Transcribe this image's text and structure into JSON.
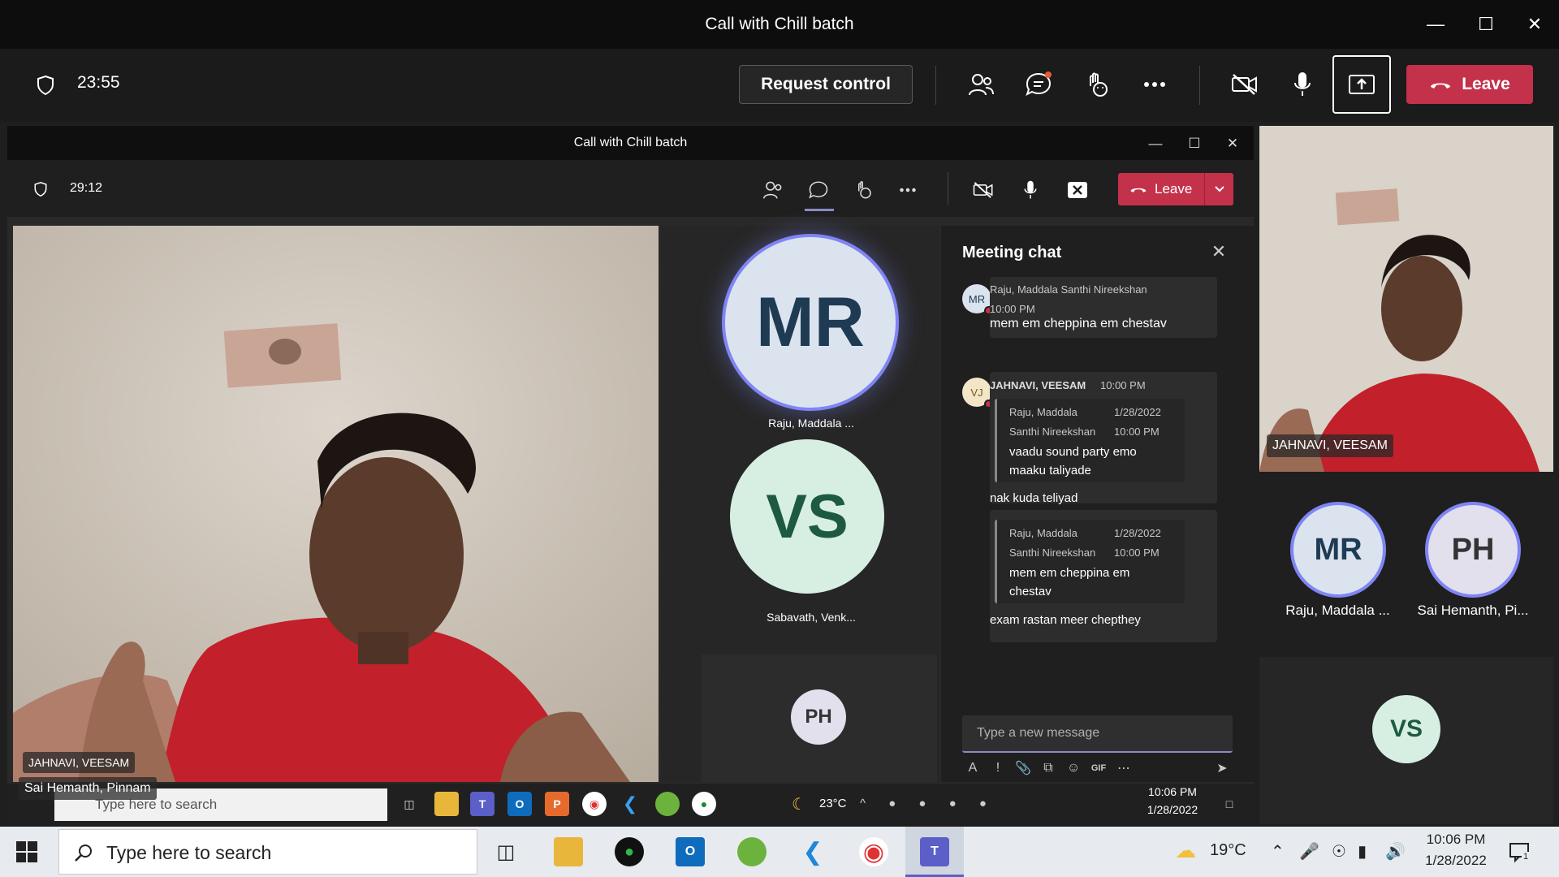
{
  "outer": {
    "title": "Call with Chill batch",
    "timer": "23:55",
    "request_control": "Request control",
    "leave": "Leave"
  },
  "inner": {
    "title": "Call with Chill batch",
    "timer": "29:12",
    "leave": "Leave"
  },
  "main_video": {
    "name": "JAHNAVI, VEESAM"
  },
  "roster": [
    {
      "initials": "MR",
      "label": "Raju, Maddala ..."
    },
    {
      "initials": "VS",
      "label": "Sabavath, Venk..."
    },
    {
      "initials": "PH"
    }
  ],
  "chat": {
    "title": "Meeting chat",
    "messages": [
      {
        "avatar": "MR",
        "author": "Raju, Maddala Santhi Nireekshan",
        "time": "10:00 PM",
        "text": "mem em cheppina em chestav"
      },
      {
        "avatar": "VJ",
        "author": "JAHNAVI, VEESAM",
        "time": "10:00 PM",
        "quote": {
          "author_line1": "Raju, Maddala",
          "author_line2": "Santhi Nireekshan",
          "date": "1/28/2022",
          "time": "10:00 PM",
          "text_line1": "vaadu sound party emo",
          "text_line2": "maaku taliyade"
        },
        "text": "nak kuda teliyad"
      },
      {
        "quote": {
          "author_line1": "Raju, Maddala",
          "author_line2": "Santhi Nireekshan",
          "date": "1/28/2022",
          "time": "10:00 PM",
          "text_line1": "mem em cheppina em",
          "text_line2": "chestav"
        },
        "text": "exam rastan meer chepthey"
      }
    ],
    "input_placeholder": "Type a new message"
  },
  "inner_taskbar": {
    "presenter_name": "Sai Hemanth, Pinnam",
    "search": "Type here to search",
    "weather": "23°C",
    "time": "10:06 PM",
    "date": "1/28/2022"
  },
  "right_panel": {
    "video_name": "JAHNAVI, VEESAM",
    "participants": [
      {
        "initials": "MR",
        "label": "Raju, Maddala ..."
      },
      {
        "initials": "PH",
        "label": "Sai Hemanth, Pi..."
      },
      {
        "initials": "VS"
      }
    ]
  },
  "taskbar": {
    "search": "Type here to search",
    "weather": "19°C",
    "time": "10:06 PM",
    "date": "1/28/2022",
    "notifications": "1"
  },
  "colors": {
    "leave_red": "#c4314b",
    "ring_purple": "#7f85f5",
    "avatar_mr": "#dbe3ef",
    "avatar_vs": "#d7efe3"
  }
}
